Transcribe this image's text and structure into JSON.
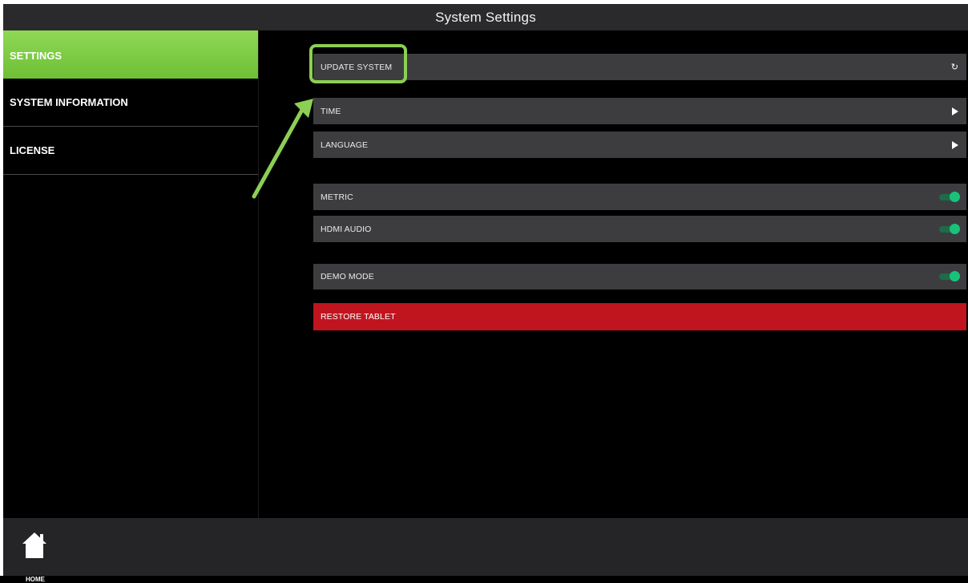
{
  "header": {
    "title": "System Settings"
  },
  "sidebar": {
    "items": [
      {
        "label": "SETTINGS",
        "active": true
      },
      {
        "label": "SYSTEM INFORMATION",
        "active": false
      },
      {
        "label": "LICENSE",
        "active": false
      }
    ]
  },
  "settings": {
    "update_system": {
      "label": "UPDATE SYSTEM",
      "icon": "refresh-icon"
    },
    "time": {
      "label": "TIME",
      "icon": "play-arrow-icon"
    },
    "language": {
      "label": "LANGUAGE",
      "icon": "play-arrow-icon"
    },
    "metric": {
      "label": "METRIC",
      "enabled": true
    },
    "hdmi_audio": {
      "label": "HDMI AUDIO",
      "enabled": true
    },
    "demo_mode": {
      "label": "DEMO MODE",
      "enabled": true
    },
    "restore_tablet": {
      "label": "RESTORE TABLET"
    }
  },
  "footer": {
    "home_label": "HOME",
    "home_icon": "home-icon"
  },
  "colors": {
    "accent_green": "#7cc943",
    "toggle_on": "#19c27a",
    "danger_red": "#c0151f",
    "row_bg": "#3d3d40"
  }
}
